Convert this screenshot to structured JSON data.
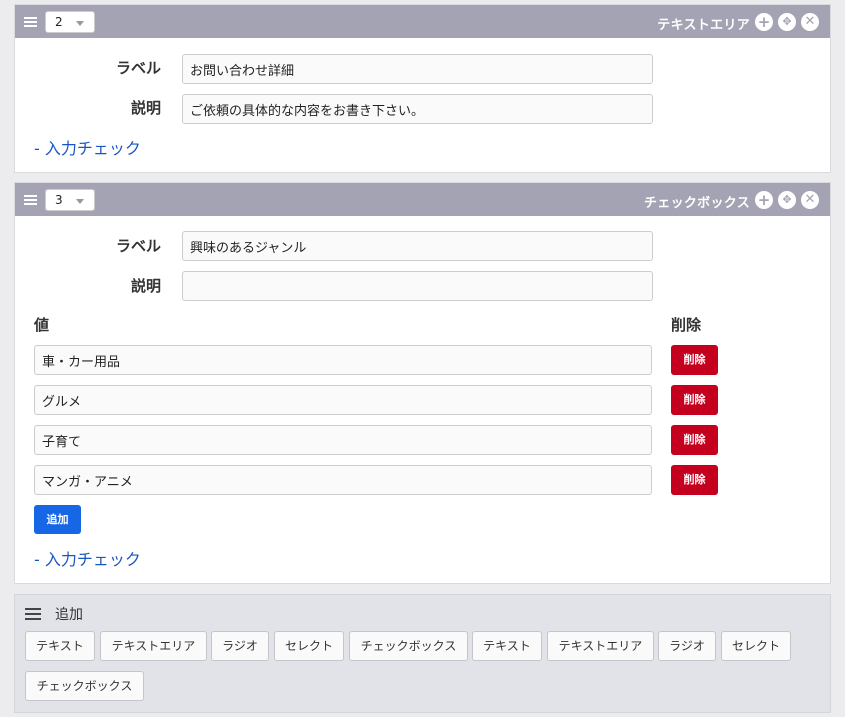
{
  "card1": {
    "number": "2",
    "title": "テキストエリア",
    "label_label": "ラベル",
    "label_value": "お問い合わせ詳細",
    "desc_label": "説明",
    "desc_value": "ご依頼の具体的な内容をお書き下さい。",
    "check_link": "- 入力チェック"
  },
  "card2": {
    "number": "3",
    "title": "チェックボックス",
    "label_label": "ラベル",
    "label_value": "興味のあるジャンル",
    "desc_label": "説明",
    "desc_value": "",
    "values_header": "値",
    "delete_header": "削除",
    "values": [
      "車・カー用品",
      "グルメ",
      "子育て",
      "マンガ・アニメ"
    ],
    "delete_label": "削除",
    "add_label": "追加",
    "check_link": "- 入力チェック"
  },
  "add_panel": {
    "title": "追加",
    "buttons": [
      "テキスト",
      "テキストエリア",
      "ラジオ",
      "セレクト",
      "チェックボックス",
      "テキスト",
      "テキストエリア",
      "ラジオ",
      "セレクト",
      "チェックボックス"
    ]
  },
  "icons": {
    "plus": "+",
    "move": "✥",
    "close": "✕"
  }
}
